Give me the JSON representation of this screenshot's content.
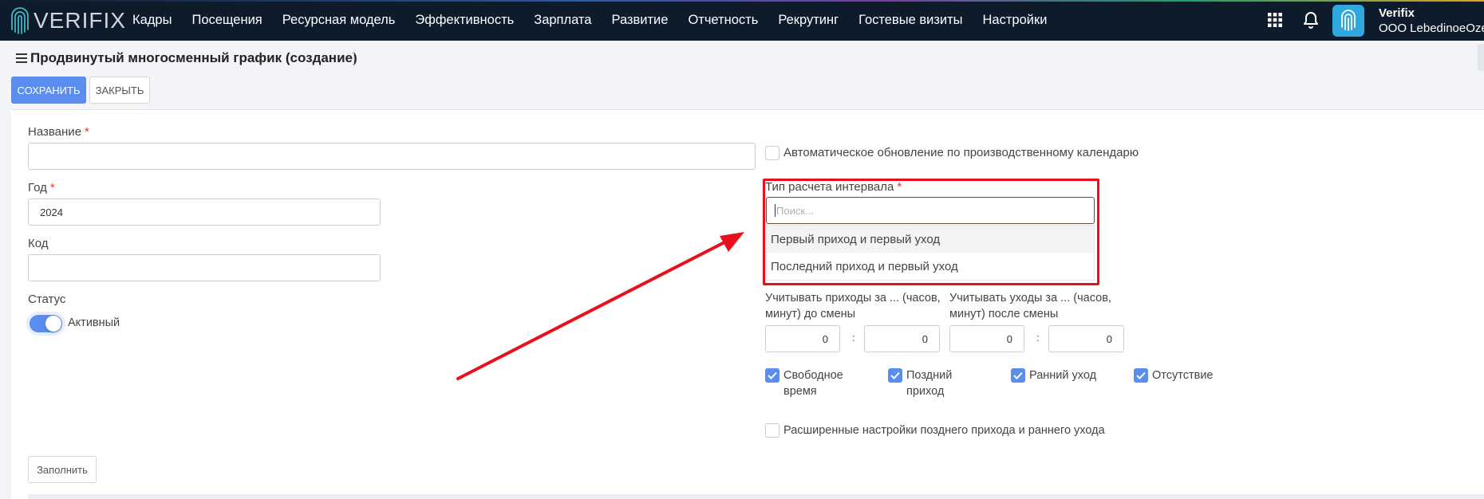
{
  "nav": {
    "logo_text": "VERIFIX",
    "menu": [
      "Кадры",
      "Посещения",
      "Ресурсная модель",
      "Эффективность",
      "Зарплата",
      "Развитие",
      "Отчетность",
      "Рекрутинг",
      "Гостевые визиты",
      "Настройки"
    ],
    "user_name": "Verifix",
    "user_org": "ООО LebedinoeOzero",
    "icons": [
      "grid-icon",
      "bell-icon",
      "fingerprint-icon"
    ]
  },
  "page": {
    "title": "Продвинутый многосменный график (создание)",
    "save_label": "СОХРАНИТЬ",
    "close_label": "ЗАКРЫТЬ"
  },
  "form": {
    "name_label": "Название",
    "name_value": "",
    "year_label": "Год",
    "year_value": "2024",
    "code_label": "Код",
    "code_value": "",
    "status_label": "Статус",
    "status_value": "Активный",
    "status_on": true,
    "required_mark": "*",
    "auto_update_label": "Автоматическое обновление по производственному календарю",
    "interval_type_label": "Тип расчета интервала",
    "search_placeholder": "Поиск...",
    "interval_options": [
      "Первый приход и первый уход",
      "Последний приход и первый уход"
    ],
    "arrivals_label_1": "Учитывать приходы за ... (часов,",
    "arrivals_label_2": "минут) до смены",
    "departures_label_1": "Учитывать уходы за ... (часов,",
    "departures_label_2": "минут) после смены",
    "arrivals_hours": "0",
    "arrivals_minutes": "0",
    "departures_hours": "0",
    "departures_minutes": "0",
    "time_separator": ":",
    "checks": [
      {
        "line1": "Свободное",
        "line2": "время",
        "checked": true
      },
      {
        "line1": "Поздний",
        "line2": "приход",
        "checked": true
      },
      {
        "line1": "Ранний уход",
        "line2": "",
        "checked": true
      },
      {
        "line1": "Отсутствие",
        "line2": "",
        "checked": true
      }
    ],
    "extended_label": "Расширенные настройки позднего прихода и раннего ухода",
    "fill_label": "Заполнить"
  },
  "colors": {
    "nav_bg": "#0d1b2a",
    "accent": "#5b8def",
    "highlight": "#e8101c",
    "required": "#e53935"
  }
}
